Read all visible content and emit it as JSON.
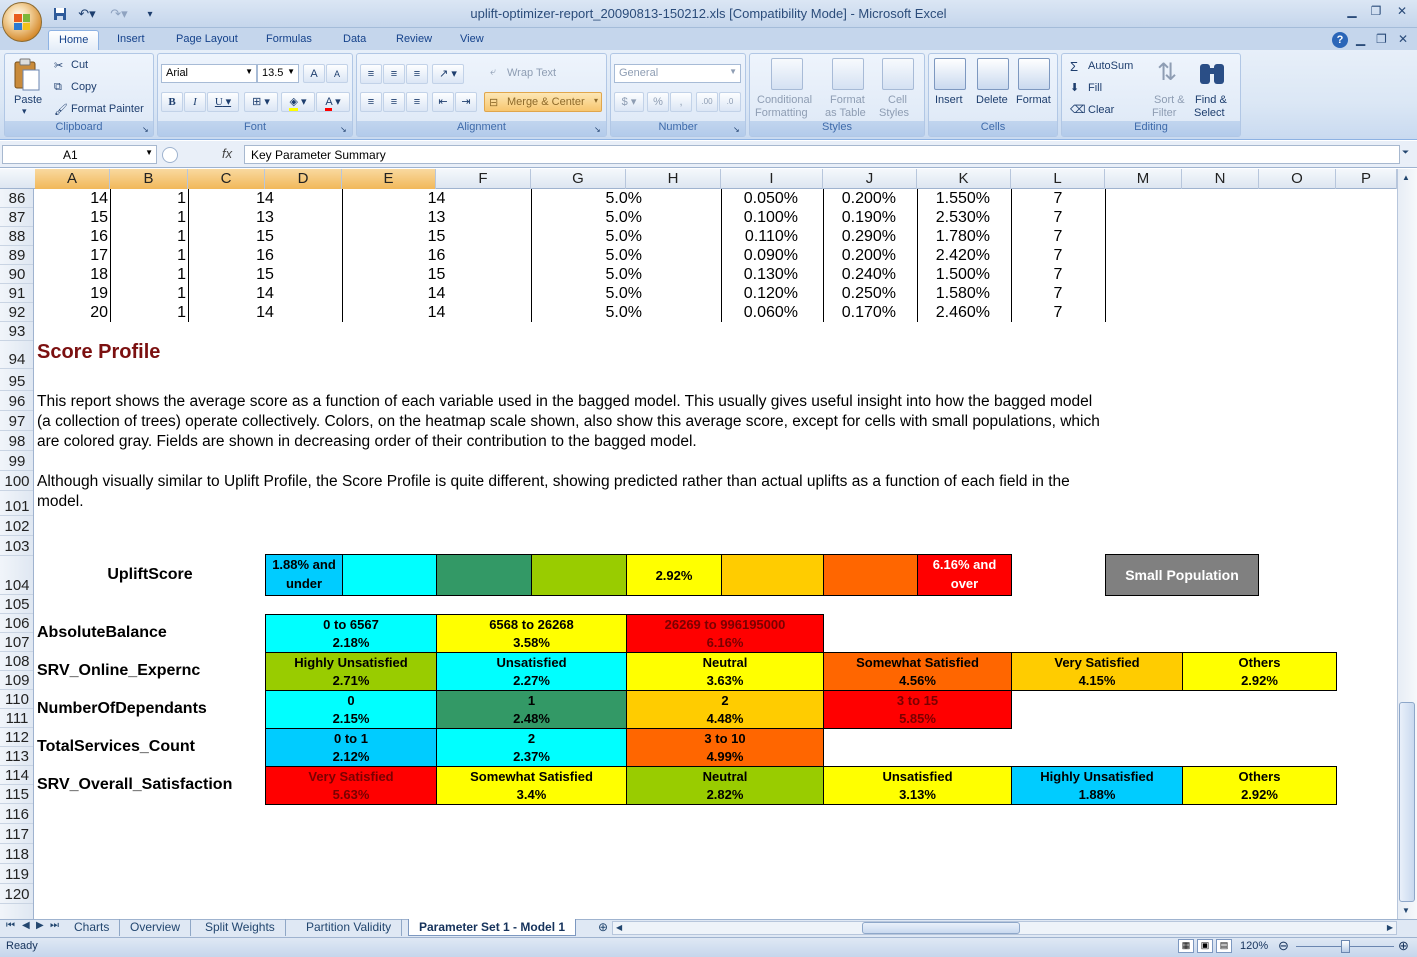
{
  "window": {
    "title": "uplift-optimizer-report_20090813-150212.xls  [Compatibility Mode] - Microsoft Excel"
  },
  "ribbon_tabs": [
    "Home",
    "Insert",
    "Page Layout",
    "Formulas",
    "Data",
    "Review",
    "View"
  ],
  "ribbon": {
    "clipboard": {
      "paste": "Paste",
      "cut": "Cut",
      "copy": "Copy",
      "format_painter": "Format Painter",
      "label": "Clipboard"
    },
    "font": {
      "name": "Arial",
      "size": "13.5",
      "label": "Font",
      "bold": "B",
      "italic": "I",
      "underline": "U",
      "grow": "A",
      "shrink": "A",
      "color": "A"
    },
    "alignment": {
      "wrap": "Wrap Text",
      "merge": "Merge & Center",
      "label": "Alignment"
    },
    "number": {
      "format": "General",
      "percent": "%",
      "comma": ",",
      "inc": ".00",
      "dec": ".0",
      "label": "Number"
    },
    "styles": {
      "cond1": "Conditional",
      "cond2": "Formatting",
      "table1": "Format",
      "table2": "as Table",
      "cell1": "Cell",
      "cell2": "Styles",
      "label": "Styles"
    },
    "cells": {
      "insert": "Insert",
      "delete": "Delete",
      "format": "Format",
      "label": "Cells"
    },
    "editing": {
      "autosum": "AutoSum",
      "fill": "Fill",
      "clear": "Clear",
      "sort1": "Sort &",
      "sort2": "Filter",
      "find1": "Find &",
      "find2": "Select",
      "label": "Editing"
    }
  },
  "formula_bar": {
    "name_box": "A1",
    "fx": "fx",
    "content": "Key Parameter Summary"
  },
  "columns": [
    "A",
    "B",
    "C",
    "D",
    "E",
    "F",
    "G",
    "H",
    "I",
    "J",
    "K",
    "L",
    "M",
    "N",
    "O",
    "P"
  ],
  "rows": [
    "86",
    "87",
    "88",
    "89",
    "90",
    "91",
    "92",
    "93",
    "94",
    "95",
    "96",
    "97",
    "98",
    "99",
    "100",
    "101",
    "102",
    "103",
    "104",
    "105",
    "106",
    "107",
    "108",
    "109",
    "110",
    "111",
    "112",
    "113",
    "114",
    "115",
    "116",
    "117",
    "118",
    "119",
    "120"
  ],
  "data_rows": [
    [
      "14",
      "1",
      "14",
      "14",
      "5.0%",
      "0.050%",
      "0.200%",
      "1.550%",
      "7"
    ],
    [
      "15",
      "1",
      "13",
      "13",
      "5.0%",
      "0.100%",
      "0.190%",
      "2.530%",
      "7"
    ],
    [
      "16",
      "1",
      "15",
      "15",
      "5.0%",
      "0.110%",
      "0.290%",
      "1.780%",
      "7"
    ],
    [
      "17",
      "1",
      "16",
      "16",
      "5.0%",
      "0.090%",
      "0.200%",
      "2.420%",
      "7"
    ],
    [
      "18",
      "1",
      "15",
      "15",
      "5.0%",
      "0.130%",
      "0.240%",
      "1.500%",
      "7"
    ],
    [
      "19",
      "1",
      "14",
      "14",
      "5.0%",
      "0.120%",
      "0.250%",
      "1.580%",
      "7"
    ],
    [
      "20",
      "1",
      "14",
      "14",
      "5.0%",
      "0.060%",
      "0.170%",
      "2.460%",
      "7"
    ]
  ],
  "score_profile": {
    "title": "Score Profile",
    "para1_line1": "This report shows the average score as a function of each variable used in the bagged model. This usually gives useful insight into how the bagged model",
    "para1_line2": "(a collection of trees) operate collectively. Colors, on the heatmap scale shown, also show this average score, except for cells with small populations, which",
    "para1_line3": "are colored gray. Fields are shown in decreasing order of their contribution to the bagged model.",
    "para2_line1": "Although visually similar to Uplift Profile, the Score Profile is quite different, showing predicted rather than actual uplifts as a function of each field in the",
    "para2_line2": "model.",
    "legend_label": "UpliftScore",
    "legend_low_1": "1.88% and",
    "legend_low_2": "under",
    "legend_mid": "2.92%",
    "legend_high_1": "6.16% and",
    "legend_high_2": "over",
    "small_population": "Small Population",
    "legend_colors": [
      "#00ccff",
      "#00ffff",
      "#339966",
      "#99cc00",
      "#ffff00",
      "#ffcc00",
      "#ff6600",
      "#ff0000"
    ],
    "small_pop_color": "#808080"
  },
  "profiles": [
    {
      "name": "AbsoluteBalance",
      "cells": [
        {
          "label": "0 to 6567",
          "value": "2.18%",
          "color": "#00ffff"
        },
        {
          "label": "6568 to 26268",
          "value": "3.58%",
          "color": "#ffff00"
        },
        {
          "label": "26269 to 996195000",
          "value": "6.16%",
          "color": "#ff0000"
        }
      ]
    },
    {
      "name": "SRV_Online_Expernc",
      "cells": [
        {
          "label": "Highly Unsatisfied",
          "value": "2.71%",
          "color": "#99cc00"
        },
        {
          "label": "Unsatisfied",
          "value": "2.27%",
          "color": "#00ffff"
        },
        {
          "label": "Neutral",
          "value": "3.63%",
          "color": "#ffff00"
        },
        {
          "label": "Somewhat Satisfied",
          "value": "4.56%",
          "color": "#ff6600"
        },
        {
          "label": "Very Satisfied",
          "value": "4.15%",
          "color": "#ffcc00"
        },
        {
          "label": "Others",
          "value": "2.92%",
          "color": "#ffff00"
        }
      ]
    },
    {
      "name": "NumberOfDependants",
      "cells": [
        {
          "label": "0",
          "value": "2.15%",
          "color": "#00ffff"
        },
        {
          "label": "1",
          "value": "2.48%",
          "color": "#339966"
        },
        {
          "label": "2",
          "value": "4.48%",
          "color": "#ffcc00"
        },
        {
          "label": "3 to 15",
          "value": "5.85%",
          "color": "#ff0000"
        }
      ]
    },
    {
      "name": "TotalServices_Count",
      "cells": [
        {
          "label": "0 to 1",
          "value": "2.12%",
          "color": "#00ccff"
        },
        {
          "label": "2",
          "value": "2.37%",
          "color": "#00ffff"
        },
        {
          "label": "3 to 10",
          "value": "4.99%",
          "color": "#ff6600"
        }
      ]
    },
    {
      "name": "SRV_Overall_Satisfaction",
      "cells": [
        {
          "label": "Very Satisfied",
          "value": "5.63%",
          "color": "#ff0000"
        },
        {
          "label": "Somewhat Satisfied",
          "value": "3.4%",
          "color": "#ffff00"
        },
        {
          "label": "Neutral",
          "value": "2.82%",
          "color": "#99cc00"
        },
        {
          "label": "Unsatisfied",
          "value": "3.13%",
          "color": "#ffff00"
        },
        {
          "label": "Highly Unsatisfied",
          "value": "1.88%",
          "color": "#00ccff"
        },
        {
          "label": "Others",
          "value": "2.92%",
          "color": "#ffff00"
        }
      ]
    }
  ],
  "sheet_tabs": [
    "Charts",
    "Overview",
    "Split Weights",
    "Partition Validity",
    "Parameter Set 1 - Model 1"
  ],
  "active_sheet": "Parameter Set 1 - Model 1",
  "status": {
    "ready": "Ready",
    "zoom": "120%"
  }
}
